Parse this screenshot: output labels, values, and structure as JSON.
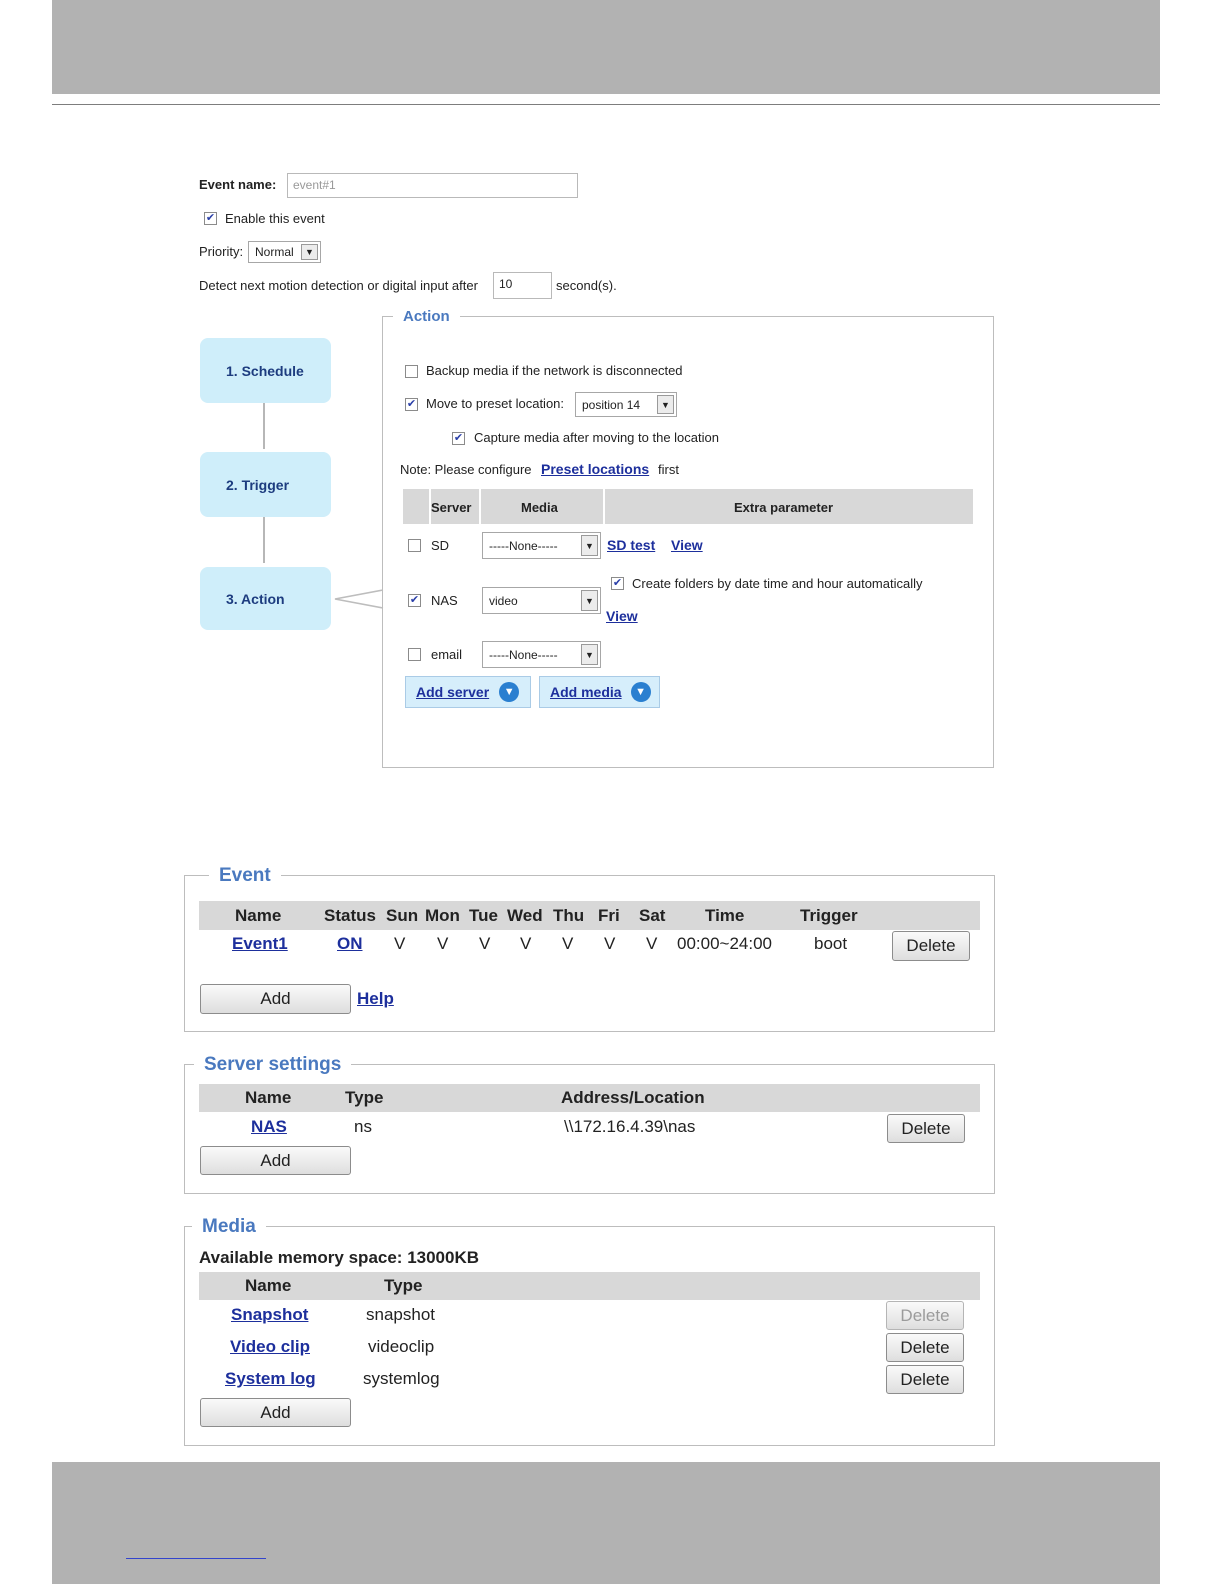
{
  "form": {
    "event_name_label": "Event name:",
    "event_name_value": "event#1",
    "enable_label": "Enable this event",
    "enable_checked": true,
    "priority_label": "Priority:",
    "priority_value": "Normal",
    "detect_label": "Detect next motion detection or digital input after",
    "detect_value": "10",
    "detect_unit": "second(s)."
  },
  "steps": [
    {
      "label": "1.  Schedule"
    },
    {
      "label": "2.  Trigger"
    },
    {
      "label": "3.  Action"
    }
  ],
  "action": {
    "legend": "Action",
    "backup_label": "Backup media if the network is disconnected",
    "backup_checked": false,
    "move_label": "Move to preset location:",
    "move_checked": true,
    "preset_value": "position 14",
    "capture_label": "Capture media after moving to the location",
    "capture_checked": true,
    "note_prefix": "Note: Please configure",
    "note_link": "Preset locations",
    "note_suffix": "first",
    "headers": {
      "server": "Server",
      "media": "Media",
      "extra": "Extra parameter"
    },
    "rows": [
      {
        "server": "SD",
        "checked": false,
        "media": "-----None-----",
        "test_link": "SD test",
        "view_link": "View"
      },
      {
        "server": "NAS",
        "checked": true,
        "media": "video",
        "folder_label": "Create folders by date time and hour automatically",
        "folder_checked": true,
        "view_link": "View"
      },
      {
        "server": "email",
        "checked": false,
        "media": "-----None-----"
      }
    ],
    "add_server": "Add server",
    "add_media": "Add media"
  },
  "event_panel": {
    "legend": "Event",
    "headers": [
      "Name",
      "Status",
      "Sun",
      "Mon",
      "Tue",
      "Wed",
      "Thu",
      "Fri",
      "Sat",
      "Time",
      "Trigger"
    ],
    "row": {
      "name": "Event1",
      "status": "ON",
      "sun": "V",
      "mon": "V",
      "tue": "V",
      "wed": "V",
      "thu": "V",
      "fri": "V",
      "sat": "V",
      "time": "00:00~24:00",
      "trigger": "boot"
    },
    "delete_label": "Delete",
    "add_label": "Add",
    "help_label": "Help"
  },
  "server_panel": {
    "legend": "Server settings",
    "headers": [
      "Name",
      "Type",
      "Address/Location"
    ],
    "row": {
      "name": "NAS",
      "type": "ns",
      "address": "\\\\172.16.4.39\\nas"
    },
    "delete_label": "Delete",
    "add_label": "Add"
  },
  "media_panel": {
    "legend": "Media",
    "memory_text": "Available memory space: 13000KB",
    "headers": [
      "Name",
      "Type"
    ],
    "rows": [
      {
        "name": "Snapshot",
        "type": "snapshot"
      },
      {
        "name": "Video clip",
        "type": "videoclip"
      },
      {
        "name": "System log",
        "type": "systemlog"
      }
    ],
    "delete_label": "Delete",
    "add_label": "Add"
  }
}
